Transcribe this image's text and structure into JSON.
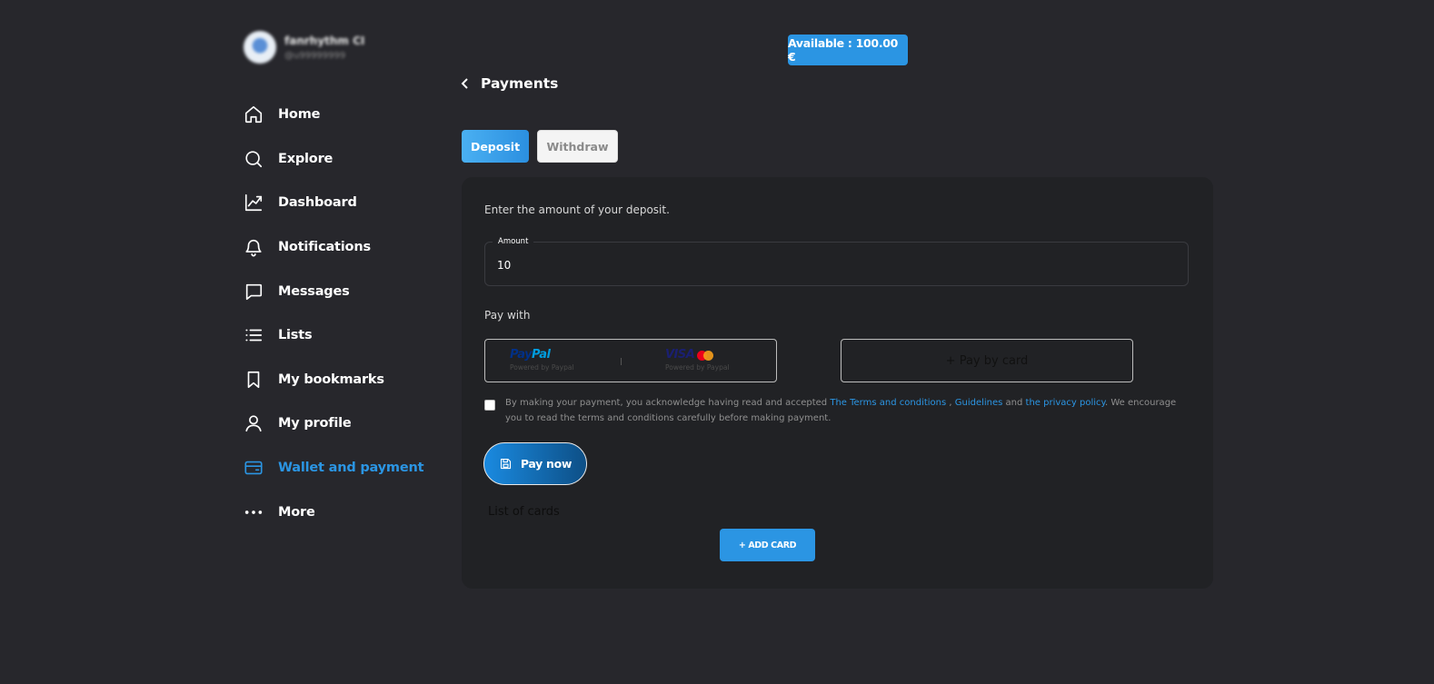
{
  "profile": {
    "name": "fanrhythm CI",
    "handle": "@u99999999"
  },
  "sidebar": {
    "items": [
      {
        "label": "Home",
        "icon": "home-icon"
      },
      {
        "label": "Explore",
        "icon": "search-icon"
      },
      {
        "label": "Dashboard",
        "icon": "chart-icon"
      },
      {
        "label": "Notifications",
        "icon": "bell-icon"
      },
      {
        "label": "Messages",
        "icon": "message-icon"
      },
      {
        "label": "Lists",
        "icon": "list-icon"
      },
      {
        "label": "My bookmarks",
        "icon": "bookmark-icon"
      },
      {
        "label": "My profile",
        "icon": "user-icon"
      },
      {
        "label": "Wallet and payment",
        "icon": "wallet-icon",
        "active": true
      },
      {
        "label": "More",
        "icon": "more-icon"
      }
    ]
  },
  "balance": {
    "label": "Available : 100.00 €"
  },
  "header": {
    "title": "Payments"
  },
  "tabs": {
    "deposit": "Deposit",
    "withdraw": "Withdraw",
    "active": "deposit"
  },
  "deposit": {
    "intro": "Enter the amount of your deposit.",
    "amount_label": "Amount",
    "amount_value": "10",
    "pay_with": "Pay with",
    "paypal": {
      "logo_part1": "Pay",
      "logo_part2": "Pal",
      "visa": "VISA",
      "powered_paypal": "Powered by Paypal",
      "powered_visa": "Powered by Paypal",
      "separator": "|"
    },
    "pay_by_card": "+ Pay by card",
    "consent": {
      "checked": false,
      "text_before": "By making your payment, you acknowledge having read and accepted ",
      "terms_link": "The Terms and conditions",
      "sep1": " , ",
      "guidelines_link": "Guidelines",
      "sep2": " and ",
      "privacy_link": "the privacy policy",
      "text_after": ". We encourage you to read the terms and conditions carefully before making payment."
    },
    "pay_now": "Pay now",
    "list_of_cards": "List of cards",
    "add_card": "+ ADD CARD"
  },
  "colors": {
    "background": "#27272c",
    "panel": "#212225",
    "accent": "#2b95e3"
  }
}
